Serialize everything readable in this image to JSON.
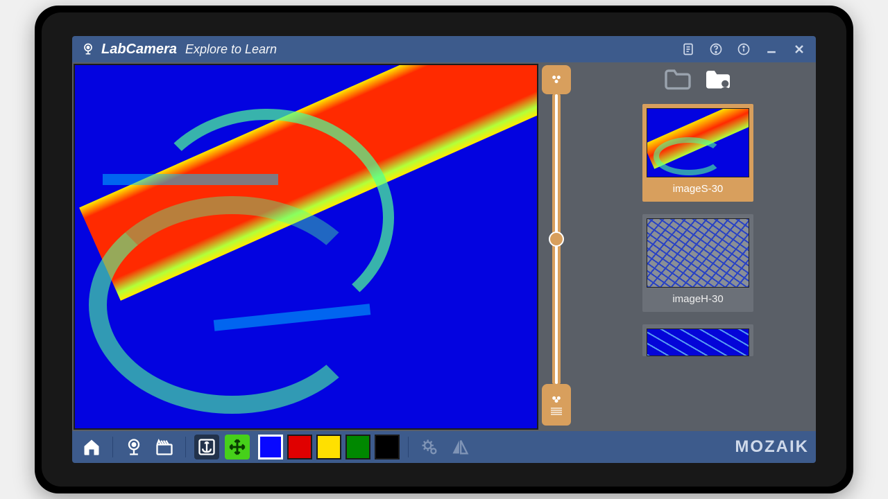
{
  "titlebar": {
    "brand": "LabCamera",
    "tagline": "Explore to Learn"
  },
  "slider": {
    "position_percent": 50
  },
  "gallery": {
    "items": [
      {
        "label": "imageS-30",
        "selected": true
      },
      {
        "label": "imageH-30",
        "selected": false
      },
      {
        "label": "",
        "selected": false
      }
    ]
  },
  "swatches": {
    "colors": [
      "#0808ff",
      "#e00000",
      "#ffe000",
      "#008800",
      "#000000"
    ],
    "selected_index": 0
  },
  "footer_brand": "MOZAIK"
}
